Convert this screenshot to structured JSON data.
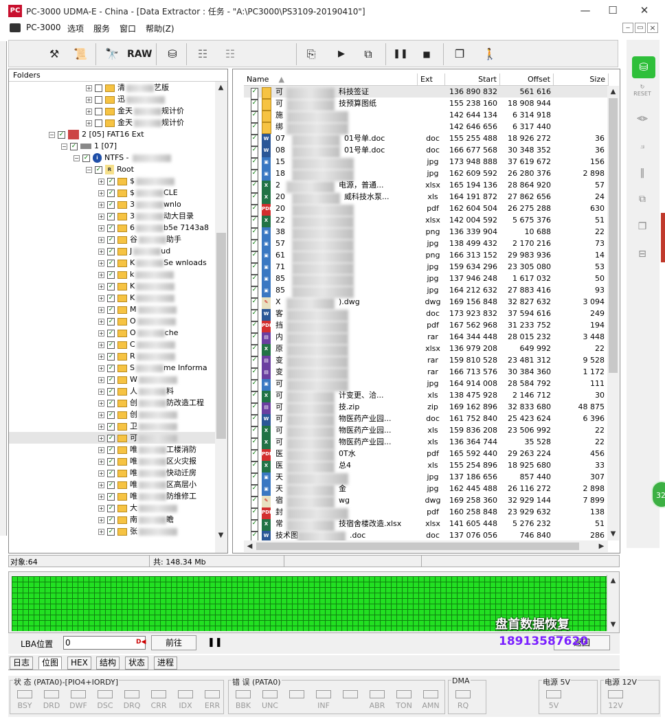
{
  "window": {
    "title": "PC-3000 UDMA-E - China - [Data Extractor : 任务 - \"A:\\PC3000\\PS3109-20190410\"]",
    "logo": "PC",
    "minimize": "—",
    "maximize": "☐",
    "close": "✕"
  },
  "menu": [
    "PC-3000",
    "选项",
    "服务",
    "窗口",
    "帮助(Z)"
  ],
  "mdi_controls": [
    "‒",
    "▭",
    "×"
  ],
  "toolbar": {
    "raw_label": "RAW"
  },
  "folders": {
    "header": "Folders",
    "rows": [
      {
        "ind": 112,
        "text": "清",
        "suffix": "艺版"
      },
      {
        "ind": 112,
        "text": "迅",
        "suffix": ""
      },
      {
        "ind": 112,
        "text": "金天",
        "suffix": "规计价"
      },
      {
        "ind": 112,
        "text": "金天",
        "suffix": "规计价"
      },
      {
        "ind": 58,
        "text": "2 [05] FAT16 Ext",
        "suffix": "",
        "kind": "disk"
      },
      {
        "ind": 76,
        "text": "1 [07]",
        "suffix": "",
        "kind": "drive"
      },
      {
        "ind": 94,
        "text": "NTFS - ",
        "suffix": "",
        "kind": "info"
      },
      {
        "ind": 112,
        "text": "Root",
        "suffix": "",
        "kind": "root"
      },
      {
        "ind": 130,
        "text": "$",
        "suffix": ""
      },
      {
        "ind": 130,
        "text": "$",
        "suffix": "CLE"
      },
      {
        "ind": 130,
        "text": "3",
        "suffix": "wnlo"
      },
      {
        "ind": 130,
        "text": "3",
        "suffix": "动大目录"
      },
      {
        "ind": 130,
        "text": "6",
        "suffix": "b5e  7143a8"
      },
      {
        "ind": 130,
        "text": "谷",
        "suffix": "助手"
      },
      {
        "ind": 130,
        "text": "J",
        "suffix": "ud"
      },
      {
        "ind": 130,
        "text": "K",
        "suffix": "Se  wnloads"
      },
      {
        "ind": 130,
        "text": "k",
        "suffix": ""
      },
      {
        "ind": 130,
        "text": "K",
        "suffix": ""
      },
      {
        "ind": 130,
        "text": "K",
        "suffix": ""
      },
      {
        "ind": 130,
        "text": "M",
        "suffix": ""
      },
      {
        "ind": 130,
        "text": "O",
        "suffix": ""
      },
      {
        "ind": 130,
        "text": "O",
        "suffix": "che"
      },
      {
        "ind": 130,
        "text": "C",
        "suffix": ""
      },
      {
        "ind": 130,
        "text": "R",
        "suffix": ""
      },
      {
        "ind": 130,
        "text": "S",
        "suffix": "me Informa"
      },
      {
        "ind": 130,
        "text": "W",
        "suffix": ""
      },
      {
        "ind": 130,
        "text": "人",
        "suffix": "料"
      },
      {
        "ind": 130,
        "text": "创",
        "suffix": "防改造工程"
      },
      {
        "ind": 130,
        "text": "创",
        "suffix": ""
      },
      {
        "ind": 130,
        "text": "卫",
        "suffix": ""
      },
      {
        "ind": 130,
        "text": "可",
        "suffix": "",
        "selected": true
      },
      {
        "ind": 130,
        "text": "唯",
        "suffix": "工楼消防"
      },
      {
        "ind": 130,
        "text": "唯",
        "suffix": "区火灾报"
      },
      {
        "ind": 130,
        "text": "唯",
        "suffix": "快动迁房"
      },
      {
        "ind": 130,
        "text": "唯",
        "suffix": "区高层小"
      },
      {
        "ind": 130,
        "text": "唯",
        "suffix": "防维修工"
      },
      {
        "ind": 130,
        "text": "大",
        "suffix": ""
      },
      {
        "ind": 130,
        "text": "南",
        "suffix": "瞻"
      },
      {
        "ind": 130,
        "text": "张",
        "suffix": ""
      }
    ]
  },
  "files": {
    "columns": {
      "name": "Name",
      "ext": "Ext",
      "start": "Start",
      "offset": "Offset",
      "size": "Size"
    },
    "rows": [
      {
        "icon": "folder",
        "name": "可",
        "name2": "科技签证",
        "ext": "",
        "start": "136 890 832",
        "offset": "561 616",
        "size": ""
      },
      {
        "icon": "folder",
        "name": "可",
        "name2": "技预算图纸",
        "ext": "",
        "start": "155 238 160",
        "offset": "18 908 944",
        "size": ""
      },
      {
        "icon": "folder",
        "name": "施",
        "name2": "",
        "ext": "",
        "start": "142 644 134",
        "offset": "6 314 918",
        "size": ""
      },
      {
        "icon": "folder",
        "name": "绑",
        "name2": "",
        "ext": "",
        "start": "142 646 656",
        "offset": "6 317 440",
        "size": ""
      },
      {
        "icon": "doc",
        "name": "07",
        "name2": "01号单.doc",
        "ext": "doc",
        "start": "155 255 488",
        "offset": "18 926 272",
        "size": "36"
      },
      {
        "icon": "doc",
        "name": "08",
        "name2": "01号单.doc",
        "ext": "doc",
        "start": "166 677 568",
        "offset": "30 348 352",
        "size": "36"
      },
      {
        "icon": "jpg",
        "name": "15",
        "name2": "",
        "ext": "jpg",
        "start": "173 948 888",
        "offset": "37 619 672",
        "size": "156"
      },
      {
        "icon": "jpg",
        "name": "18",
        "name2": "",
        "ext": "jpg",
        "start": "162 609 592",
        "offset": "26 280 376",
        "size": "2 898"
      },
      {
        "icon": "xls",
        "name": "2",
        "name2": "电源，普通...",
        "ext": "xlsx",
        "start": "165 194 136",
        "offset": "28 864 920",
        "size": "57"
      },
      {
        "icon": "xls",
        "name": "20",
        "name2": "威科技水泵...",
        "ext": "xls",
        "start": "164 191 872",
        "offset": "27 862 656",
        "size": "24"
      },
      {
        "icon": "pdf",
        "name": "20",
        "name2": "",
        "ext": "pdf",
        "start": "162 604 504",
        "offset": "26 275 288",
        "size": "630"
      },
      {
        "icon": "xls",
        "name": "22",
        "name2": "",
        "ext": "xlsx",
        "start": "142 004 592",
        "offset": "5 675 376",
        "size": "51"
      },
      {
        "icon": "jpg",
        "name": "38",
        "name2": "",
        "ext": "png",
        "start": "136 339 904",
        "offset": "10 688",
        "size": "22"
      },
      {
        "icon": "jpg",
        "name": "57",
        "name2": "",
        "ext": "jpg",
        "start": "138 499 432",
        "offset": "2 170 216",
        "size": "73"
      },
      {
        "icon": "jpg",
        "name": "61",
        "name2": "",
        "ext": "png",
        "start": "166 313 152",
        "offset": "29 983 936",
        "size": "14"
      },
      {
        "icon": "jpg",
        "name": "71",
        "name2": "",
        "ext": "jpg",
        "start": "159 634 296",
        "offset": "23 305 080",
        "size": "53"
      },
      {
        "icon": "jpg",
        "name": "85",
        "name2": "",
        "ext": "jpg",
        "start": "137 946 248",
        "offset": "1 617 032",
        "size": "50"
      },
      {
        "icon": "jpg",
        "name": "85",
        "name2": "",
        "ext": "jpg",
        "start": "164 212 632",
        "offset": "27 883 416",
        "size": "93"
      },
      {
        "icon": "dwg",
        "name": "X",
        "name2": ").dwg",
        "ext": "dwg",
        "start": "169 156 848",
        "offset": "32 827 632",
        "size": "3 094"
      },
      {
        "icon": "doc",
        "name": "客",
        "name2": "",
        "ext": "doc",
        "start": "173 923 832",
        "offset": "37 594 616",
        "size": "249"
      },
      {
        "icon": "pdf",
        "name": "挡",
        "name2": "",
        "ext": "pdf",
        "start": "167 562 968",
        "offset": "31 233 752",
        "size": "194"
      },
      {
        "icon": "rar",
        "name": "内",
        "name2": "",
        "ext": "rar",
        "start": "164 344 448",
        "offset": "28 015 232",
        "size": "3 448"
      },
      {
        "icon": "xls",
        "name": "原",
        "name2": "",
        "ext": "xlsx",
        "start": "136 979 208",
        "offset": "649 992",
        "size": "22"
      },
      {
        "icon": "rar",
        "name": "变",
        "name2": "",
        "ext": "rar",
        "start": "159 810 528",
        "offset": "23 481 312",
        "size": "9 528"
      },
      {
        "icon": "rar",
        "name": "变",
        "name2": "",
        "ext": "rar",
        "start": "166 713 576",
        "offset": "30 384 360",
        "size": "1 172"
      },
      {
        "icon": "jpg",
        "name": "可",
        "name2": "",
        "ext": "jpg",
        "start": "164 914 008",
        "offset": "28 584 792",
        "size": "111"
      },
      {
        "icon": "xls",
        "name": "可",
        "name2": "计变更、洽...",
        "ext": "xls",
        "start": "138 475 928",
        "offset": "2 146 712",
        "size": "30"
      },
      {
        "icon": "rar",
        "name": "可",
        "name2": "技.zip",
        "ext": "zip",
        "start": "169 162 896",
        "offset": "32 833 680",
        "size": "48 875"
      },
      {
        "icon": "doc",
        "name": "可",
        "name2": "物医药产业园...",
        "ext": "doc",
        "start": "161 752 840",
        "offset": "25 423 624",
        "size": "6 396"
      },
      {
        "icon": "xls",
        "name": "可",
        "name2": "物医药产业园...",
        "ext": "xls",
        "start": "159 836 208",
        "offset": "23 506 992",
        "size": "22"
      },
      {
        "icon": "xls",
        "name": "可",
        "name2": "物医药产业园...",
        "ext": "xls",
        "start": "136 364 744",
        "offset": "35 528",
        "size": "22"
      },
      {
        "icon": "pdf",
        "name": "医",
        "name2": "0T水",
        "ext": "pdf",
        "start": "165 592 440",
        "offset": "29 263 224",
        "size": "456"
      },
      {
        "icon": "xls",
        "name": "医",
        "name2": "总4",
        "ext": "xls",
        "start": "155 254 896",
        "offset": "18 925 680",
        "size": "33"
      },
      {
        "icon": "jpg",
        "name": "天",
        "name2": "",
        "ext": "jpg",
        "start": "137 186 656",
        "offset": "857 440",
        "size": "307"
      },
      {
        "icon": "jpg",
        "name": "天",
        "name2": "金",
        "ext": "jpg",
        "start": "162 445 488",
        "offset": "26 116 272",
        "size": "2 898"
      },
      {
        "icon": "dwg",
        "name": "宿",
        "name2": "wg",
        "ext": "dwg",
        "start": "169 258 360",
        "offset": "32 929 144",
        "size": "7 899"
      },
      {
        "icon": "pdf",
        "name": "封",
        "name2": "",
        "ext": "pdf",
        "start": "160 258 848",
        "offset": "23 929 632",
        "size": "138"
      },
      {
        "icon": "xls",
        "name": "常",
        "name2": "技宿舍楼改造.xlsx",
        "ext": "xlsx",
        "start": "141 605 448",
        "offset": "5 276 232",
        "size": "51"
      },
      {
        "icon": "doc",
        "name": "技术图",
        "name2": ".doc",
        "ext": "doc",
        "start": "137 076 056",
        "offset": "746 840",
        "size": "286"
      }
    ]
  },
  "status": {
    "objects": "对象:64",
    "total": "共: 148.34 Mb"
  },
  "lba": {
    "label": "LBA位置",
    "value": "0",
    "go_button": "前往",
    "right_button": "返回"
  },
  "tabs": [
    "日志",
    "位图",
    "HEX",
    "结构",
    "状态",
    "进程"
  ],
  "watermark": {
    "line1": "盘首数据恢复",
    "line2": "18913587620"
  },
  "bottom": {
    "status_group": "状 态 (PATA0)-[PIO4+IORDY]",
    "status_leds": [
      "BSY",
      "DRD",
      "DWF",
      "DSC",
      "DRQ",
      "CRR",
      "IDX",
      "ERR"
    ],
    "error_group": "错 误 (PATA0)",
    "error_leds": [
      "BBK",
      "UNC",
      "",
      "INF",
      "",
      "ABR",
      "TON",
      "AMN"
    ],
    "dma_group": "DMA",
    "dma_leds": [
      "RQ"
    ],
    "power5_group": "电源 5V",
    "power5_leds": [
      "5V"
    ],
    "power12_group": "电源 12V",
    "power12_leds": [
      "12V"
    ]
  },
  "badge": "32"
}
